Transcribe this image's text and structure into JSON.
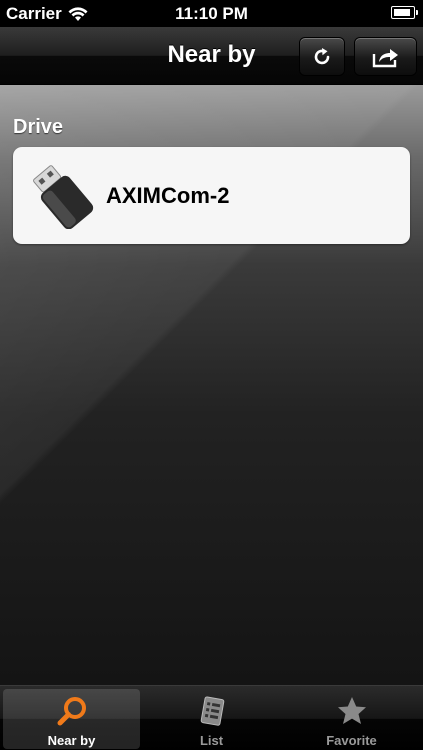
{
  "status_bar": {
    "carrier": "Carrier",
    "time": "11:10 PM",
    "battery_level": 0.9
  },
  "nav": {
    "title": "Near by",
    "refresh_icon": "refresh-icon",
    "share_icon": "share-icon"
  },
  "section": {
    "header": "Drive"
  },
  "drives": [
    {
      "name": "AXIMCom-2",
      "icon": "usb-drive-icon"
    }
  ],
  "tabs": [
    {
      "label": "Near by",
      "icon": "magnifier-icon",
      "active": true
    },
    {
      "label": "List",
      "icon": "document-list-icon",
      "active": false
    },
    {
      "label": "Favorite",
      "icon": "star-icon",
      "active": false
    }
  ],
  "colors": {
    "active_tab_icon": "#f07a1a",
    "inactive_tab": "#9a9a9a"
  }
}
